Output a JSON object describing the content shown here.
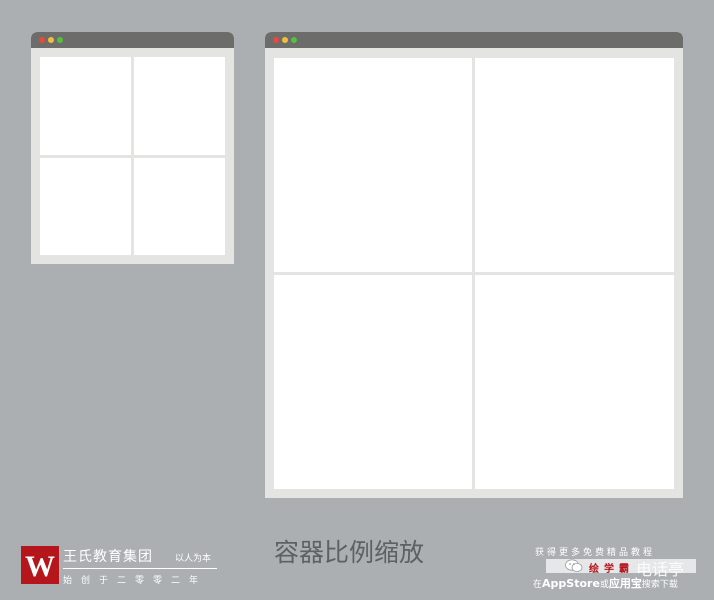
{
  "windows": {
    "small": {
      "name": "small-window",
      "traffic_lights": [
        "#e8483d",
        "#f0c03c",
        "#54c041"
      ]
    },
    "large": {
      "name": "large-window",
      "traffic_lights": [
        "#e8483d",
        "#f0c03c",
        "#54c041"
      ]
    }
  },
  "colors": {
    "background": "#abafb2",
    "titlebar": "#6c6c6a",
    "frame": "#e4e5e2",
    "cell": "#ffffff",
    "brand_red": "#b5161c"
  },
  "caption": "容器比例缩放",
  "brand": {
    "logo_letter": "W",
    "name": "王氏教育集团",
    "motto": "以人为本",
    "since": "始创于二零零二年"
  },
  "promo": {
    "line1": "获得更多免费精品教程",
    "app_name": "绘学霸",
    "icon": "wechat-icon",
    "watermark": "电话亭",
    "line2_prefix": "在",
    "line2_store1": "AppStore",
    "line2_mid": "或",
    "line2_store2": "应用宝",
    "line2_suffix": "搜索下载"
  }
}
